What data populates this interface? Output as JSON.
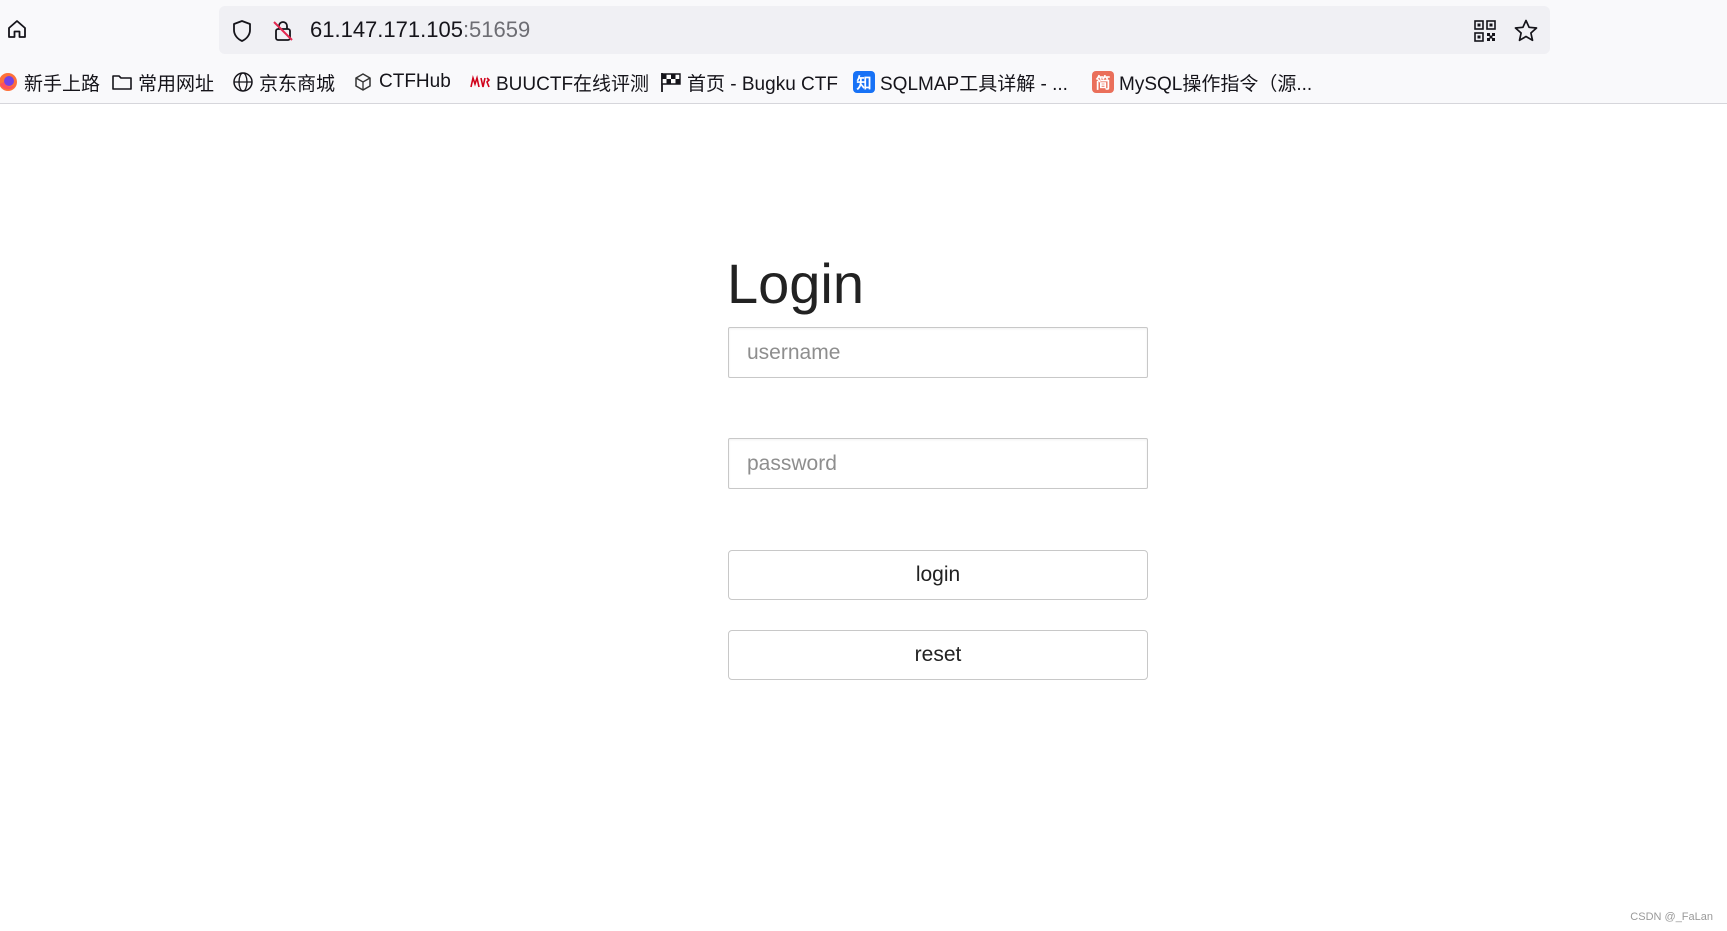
{
  "browser": {
    "url_host": "61.147.171.105",
    "url_port": ":51659",
    "bookmarks": [
      {
        "label": "新手上路",
        "icon": "firefox-icon"
      },
      {
        "label": "常用网址",
        "icon": "folder-icon"
      },
      {
        "label": "京东商城",
        "icon": "globe-icon"
      },
      {
        "label": "CTFHub",
        "icon": "cube-icon"
      },
      {
        "label": "BUUCTF在线评测",
        "icon": "buuctf-icon"
      },
      {
        "label": "首页 - Bugku CTF",
        "icon": "flag-icon"
      },
      {
        "label": "SQLMAP工具详解 - ...",
        "icon": "zhihu-icon",
        "badge": "知"
      },
      {
        "label": "MySQL操作指令（源...",
        "icon": "jianshu-icon",
        "badge": "简"
      }
    ],
    "badge_colors": {
      "zhihu": "#1772f6",
      "jianshu": "#ea6f5a"
    }
  },
  "page": {
    "title": "Login",
    "username_placeholder": "username",
    "password_placeholder": "password",
    "login_label": "login",
    "reset_label": "reset"
  },
  "watermark": "CSDN @_FaLan"
}
